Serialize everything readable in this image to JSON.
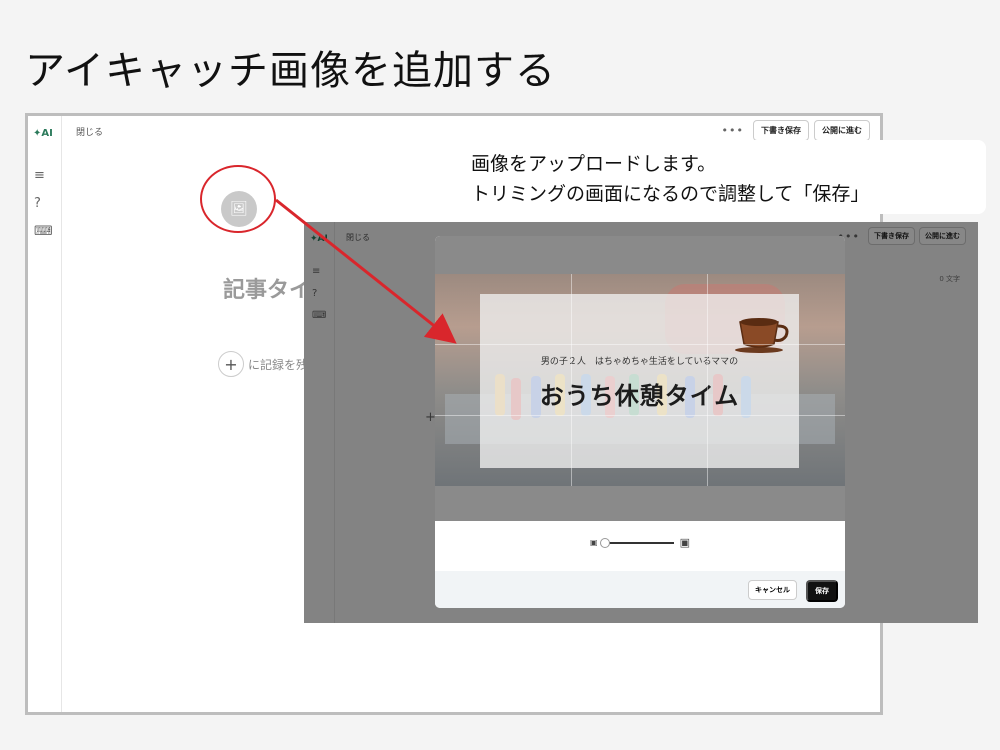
{
  "slide": {
    "title": "アイキャッチ画像を追加する"
  },
  "editor": {
    "ai_logo": "✦AI",
    "close_label": "閉じる",
    "more_label": "•••",
    "draft_save_label": "下書き保存",
    "publish_label": "公開に進む",
    "article_title_placeholder": "記事タイ",
    "body_placeholder": "に記録を残"
  },
  "callout": {
    "line1": "画像をアップロードします。",
    "line2": "トリミングの画面になるので調整して「保存」"
  },
  "inner_editor": {
    "ai_logo": "✦AI",
    "close_label": "閉じる",
    "more_label": "•••",
    "draft_save_label": "下書き保存",
    "publish_label": "公開に進む",
    "char_count": "0 文字"
  },
  "crop_modal": {
    "image_subtitle": "男の子２人　はちゃめちゃ生活をしているママの",
    "image_title": "おうち休憩タイム",
    "zoom_level": 0,
    "cancel_label": "キャンセル",
    "save_label": "保存"
  },
  "colors": {
    "highlight": "#d9262c",
    "save_button": "#111111",
    "brand_ai": "#2b7a5b"
  }
}
